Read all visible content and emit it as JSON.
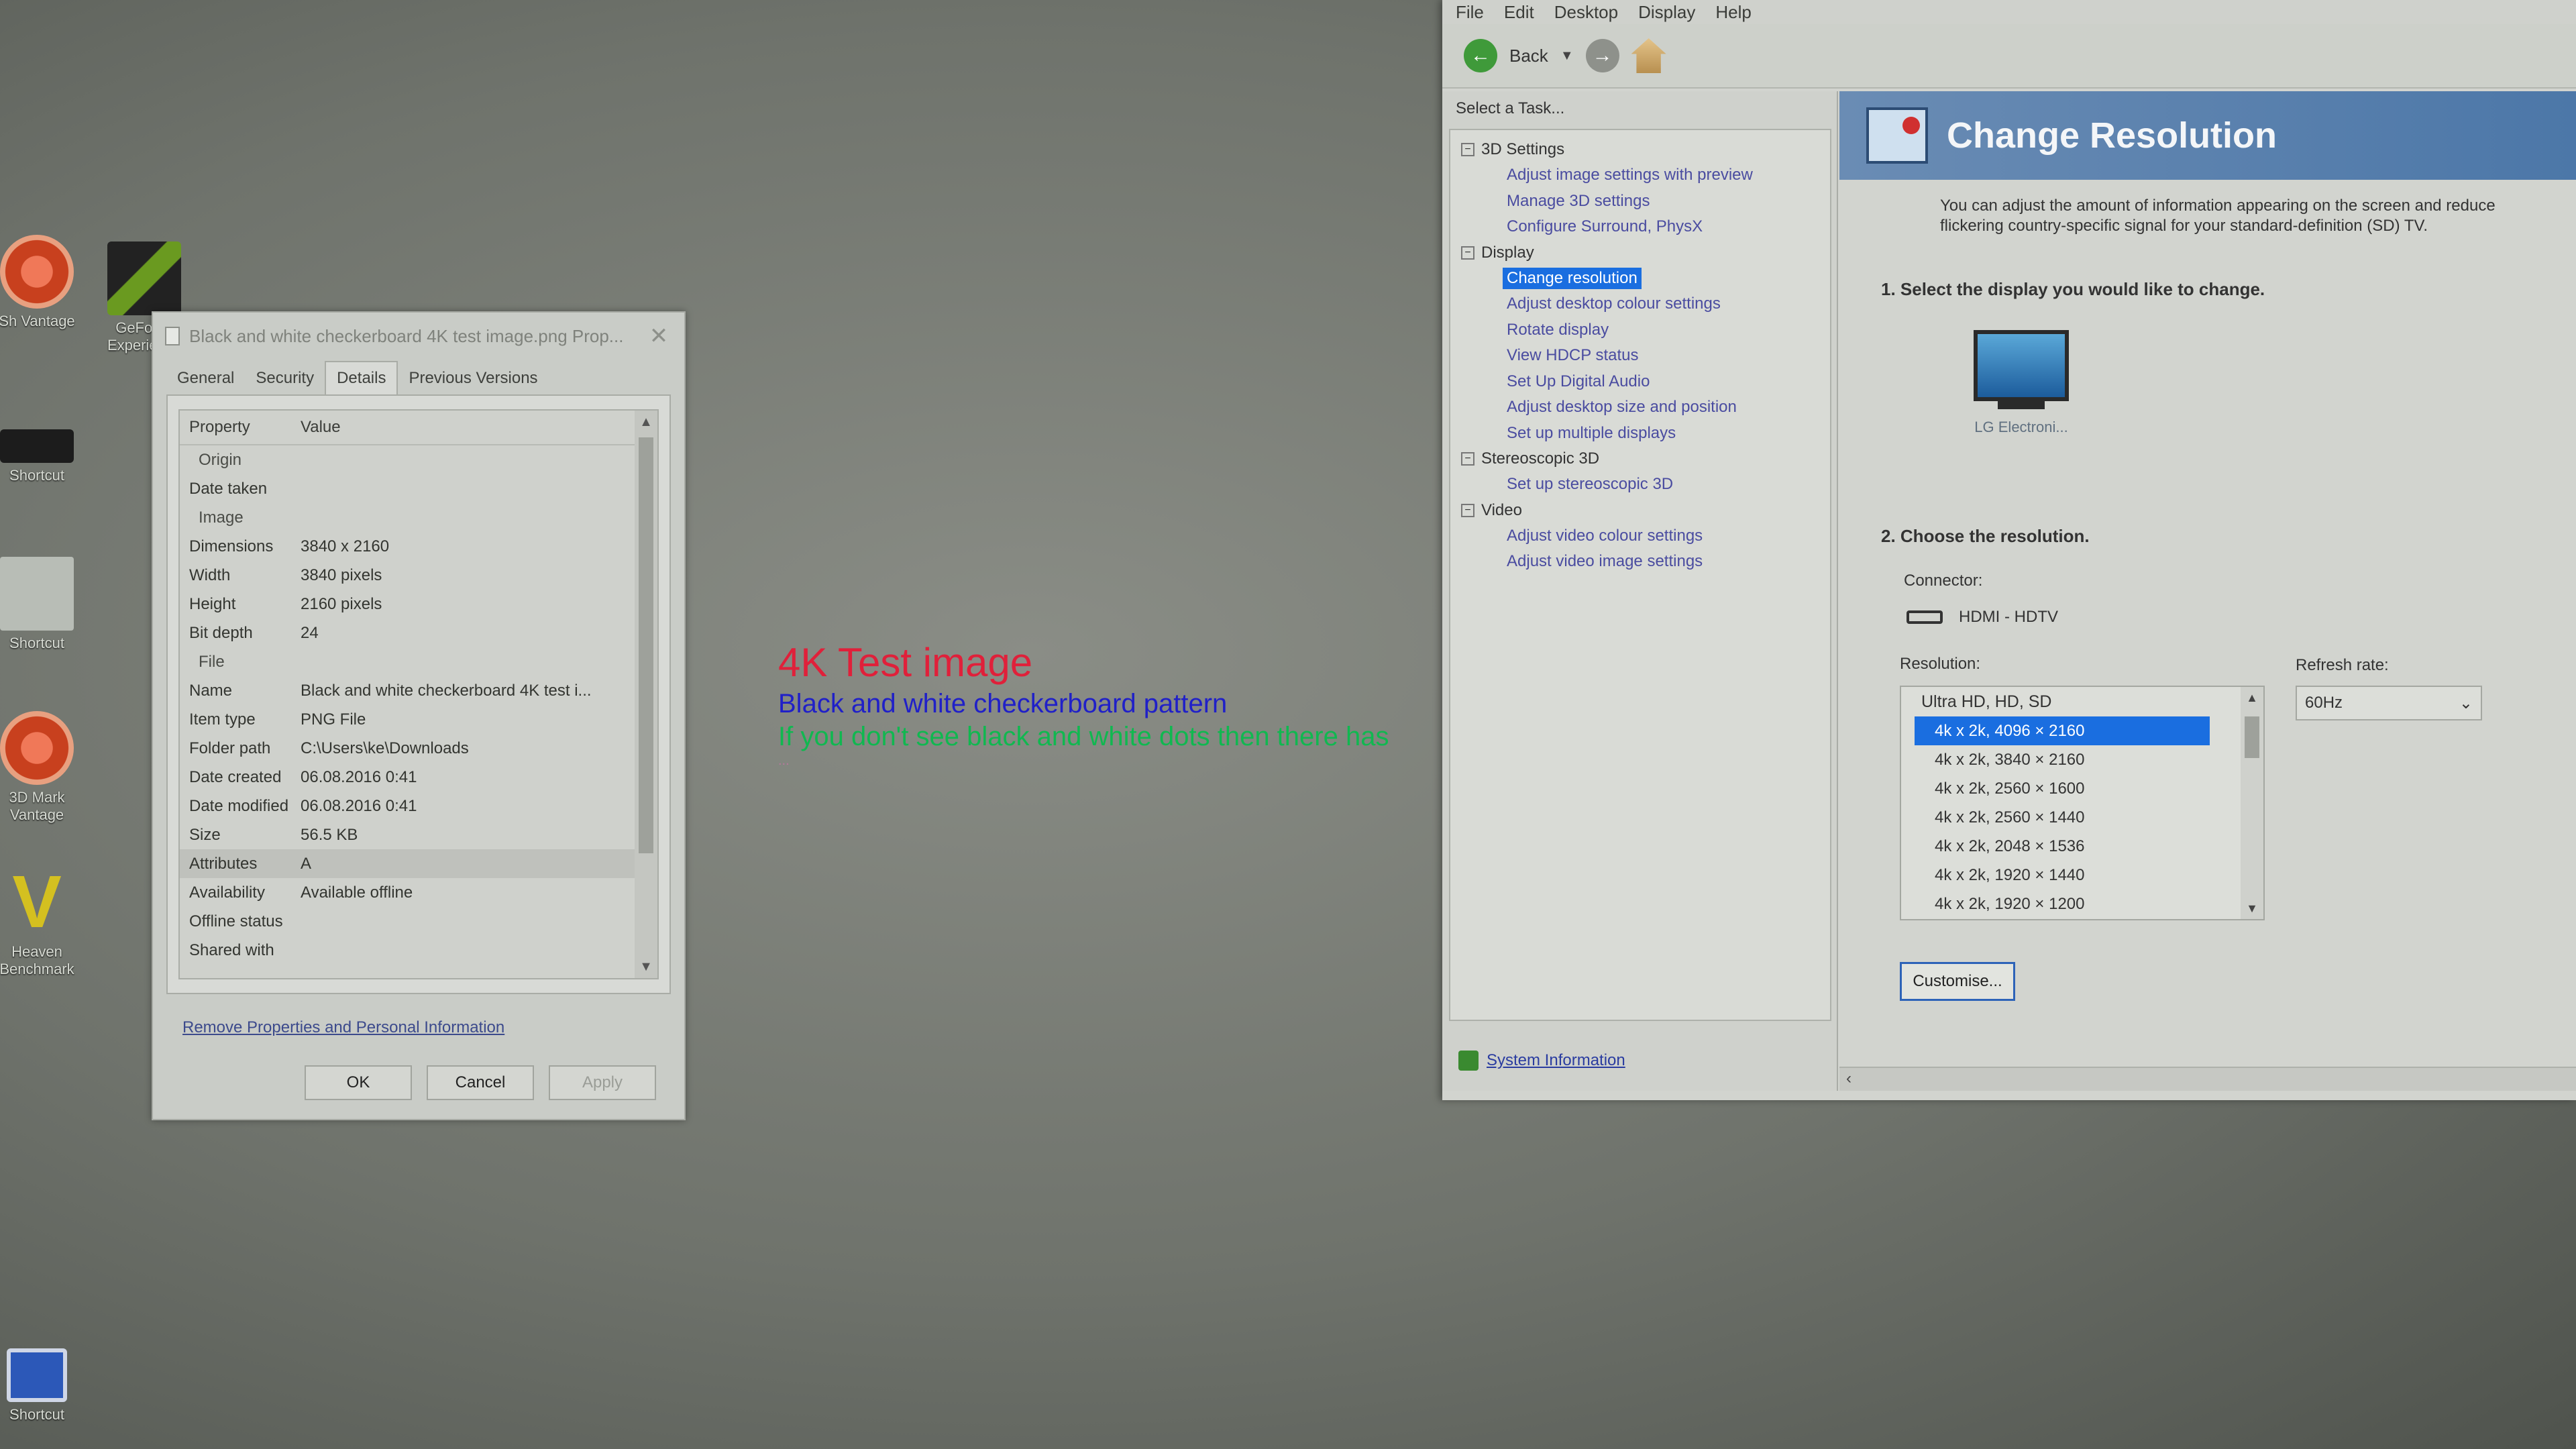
{
  "desktop": {
    "icons": [
      {
        "label": "Sh Vantage",
        "kind": "red"
      },
      {
        "label": "3D Mark Vantage",
        "kind": "red"
      },
      {
        "label": "Heaven Benchmark",
        "kind": "v"
      },
      {
        "label": "Shortcut",
        "kind": "dark"
      },
      {
        "label": "Shortcut",
        "kind": "light"
      },
      {
        "label": "Shortcut",
        "kind": "blue"
      },
      {
        "label": "GeForce Experience",
        "kind": "nv"
      }
    ],
    "wallpaper": {
      "line1": "4K Test image",
      "line2": "Black and white checkerboard pattern",
      "line3": "If you don't see black and white dots then there has",
      "line4": "..."
    }
  },
  "properties": {
    "title": "Black and white checkerboard 4K test image.png Prop...",
    "tabs": [
      "General",
      "Security",
      "Details",
      "Previous Versions"
    ],
    "active_tab": "Details",
    "columns": {
      "property": "Property",
      "value": "Value"
    },
    "rows": [
      {
        "k": "Origin",
        "v": "",
        "group": true
      },
      {
        "k": "Date taken",
        "v": ""
      },
      {
        "k": "Image",
        "v": "",
        "group": true
      },
      {
        "k": "Dimensions",
        "v": "3840 x 2160"
      },
      {
        "k": "Width",
        "v": "3840 pixels"
      },
      {
        "k": "Height",
        "v": "2160 pixels"
      },
      {
        "k": "Bit depth",
        "v": "24"
      },
      {
        "k": "File",
        "v": "",
        "group": true
      },
      {
        "k": "Name",
        "v": "Black and white checkerboard 4K test i..."
      },
      {
        "k": "Item type",
        "v": "PNG File"
      },
      {
        "k": "Folder path",
        "v": "C:\\Users\\ke\\Downloads"
      },
      {
        "k": "Date created",
        "v": "06.08.2016 0:41"
      },
      {
        "k": "Date modified",
        "v": "06.08.2016 0:41"
      },
      {
        "k": "Size",
        "v": "56.5 KB"
      },
      {
        "k": "Attributes",
        "v": "A",
        "hl": true
      },
      {
        "k": "Availability",
        "v": "Available offline"
      },
      {
        "k": "Offline status",
        "v": ""
      },
      {
        "k": "Shared with",
        "v": ""
      }
    ],
    "remove_link": "Remove Properties and Personal Information",
    "ok": "OK",
    "cancel": "Cancel",
    "apply": "Apply"
  },
  "nvcp": {
    "menu": [
      "File",
      "Edit",
      "Desktop",
      "Display",
      "Help"
    ],
    "back_label": "Back",
    "select_task": "Select a Task...",
    "tree": [
      {
        "group": "3D Settings",
        "items": [
          "Adjust image settings with preview",
          "Manage 3D settings",
          "Configure Surround, PhysX"
        ]
      },
      {
        "group": "Display",
        "items": [
          "Change resolution",
          "Adjust desktop colour settings",
          "Rotate display",
          "View HDCP status",
          "Set Up Digital Audio",
          "Adjust desktop size and position",
          "Set up multiple displays"
        ]
      },
      {
        "group": "Stereoscopic 3D",
        "items": [
          "Set up stereoscopic 3D"
        ]
      },
      {
        "group": "Video",
        "items": [
          "Adjust video colour settings",
          "Adjust video image settings"
        ]
      }
    ],
    "selected_item": "Change resolution",
    "system_info": "System Information",
    "page_title": "Change Resolution",
    "intro": "You can adjust the amount of information appearing on the screen and reduce flickering country-specific signal for your standard-definition (SD) TV.",
    "step1": "1. Select the display you would like to change.",
    "monitor_label": "LG Electroni...",
    "step2": "2. Choose the resolution.",
    "connector_label": "Connector:",
    "connector_value": "HDMI - HDTV",
    "resolution_label": "Resolution:",
    "refresh_label": "Refresh rate:",
    "refresh_value": "60Hz",
    "res_category": "Ultra HD, HD, SD",
    "resolutions": [
      "4k x 2k, 4096 × 2160",
      "4k x 2k, 3840 × 2160",
      "4k x 2k, 2560 × 1600",
      "4k x 2k, 2560 × 1440",
      "4k x 2k, 2048 × 1536",
      "4k x 2k, 1920 × 1440",
      "4k x 2k, 1920 × 1200"
    ],
    "selected_resolution": "4k x 2k, 4096 × 2160",
    "customise": "Customise...",
    "accent": "#1a6ee0"
  }
}
